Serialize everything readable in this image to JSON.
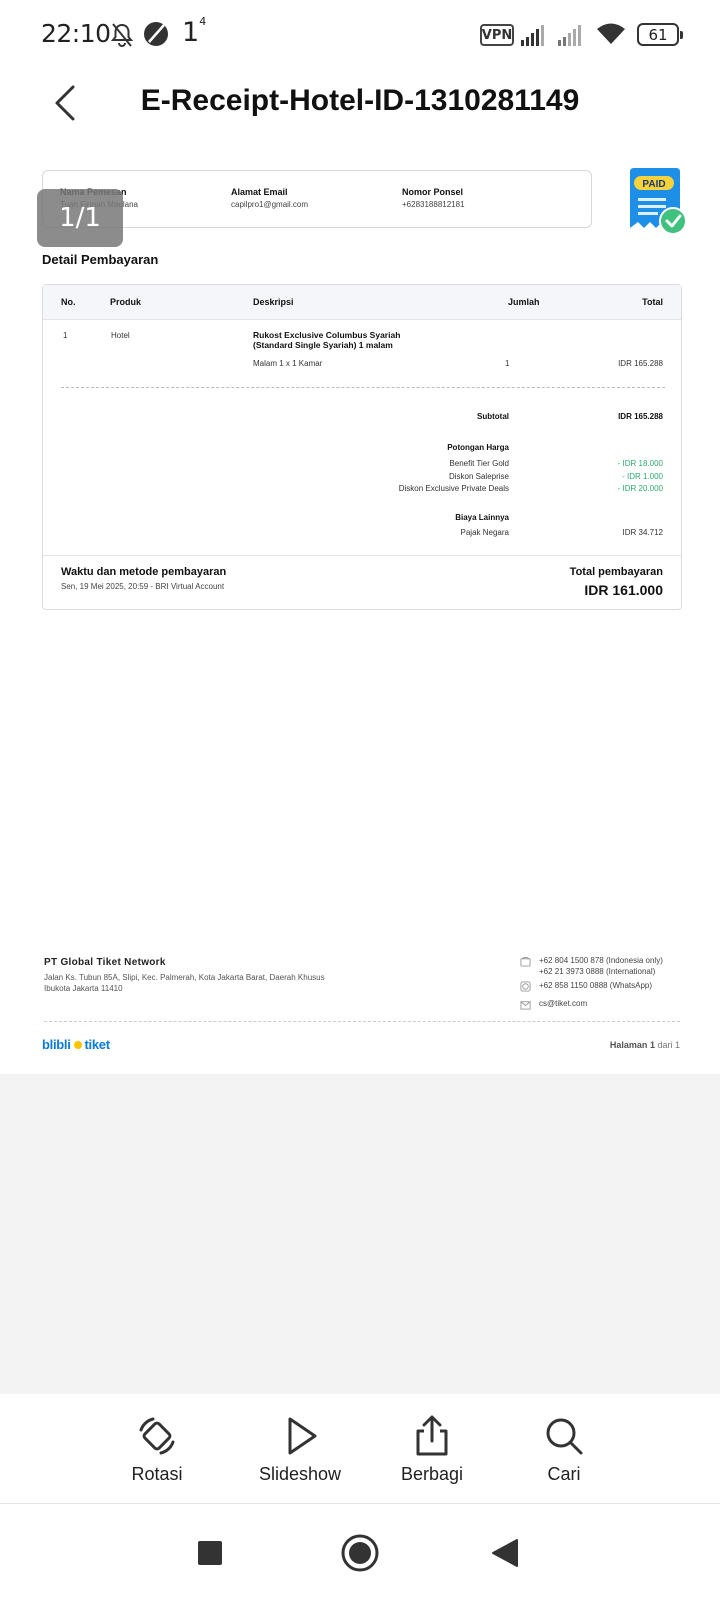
{
  "status_bar": {
    "time": "22:10",
    "extra_digit": "1",
    "extra_sup": "4",
    "vpn": "VPN",
    "battery": "61"
  },
  "header": {
    "title": "E-Receipt-Hotel-ID-1310281149"
  },
  "page_indicator": "1/1",
  "info": {
    "name_label": "Nama Pemesan",
    "name_value": "Tuan Firman Maulana",
    "email_label": "Alamat Email",
    "email_value": "capilpro1@gmail.com",
    "phone_label": "Nomor Ponsel",
    "phone_value": "+6283188812181"
  },
  "badge": "PAID",
  "payment_details": {
    "section_title": "Detail Pembayaran",
    "columns": {
      "no": "No.",
      "product": "Produk",
      "description": "Deskripsi",
      "quantity": "Jumlah",
      "total": "Total"
    },
    "row": {
      "no": "1",
      "product": "Hotel",
      "desc_line1": "Rukost Exclusive Columbus Syariah",
      "desc_line2": "(Standard Single Syariah) 1 malam",
      "desc_detail": "Malam 1 x 1 Kamar",
      "quantity": "1",
      "total": "IDR 165.288"
    },
    "subtotal_label": "Subtotal",
    "subtotal_value": "IDR 165.288",
    "discount_title": "Potongan Harga",
    "discounts": [
      {
        "label": "Benefit Tier Gold",
        "value": "- IDR 18.000"
      },
      {
        "label": "Diskon Saleprise",
        "value": "- IDR 1.000"
      },
      {
        "label": "Diskon Exclusive Private Deals",
        "value": "- IDR 20.000"
      }
    ],
    "other_title": "Biaya Lainnya",
    "tax_label": "Pajak Negara",
    "tax_value": "IDR 34.712",
    "time_method_label": "Waktu dan metode pembayaran",
    "time_method_value": "Sen, 19 Mei 2025, 20:59 - BRI Virtual Account",
    "total_label": "Total pembayaran",
    "total_value": "IDR 161.000"
  },
  "footer": {
    "company": "PT Global Tiket Network",
    "address": "Jalan Ks. Tubun 85A, Slipi, Kec. Palmerah, Kota Jakarta Barat, Daerah Khusus Ibukota Jakarta 11410",
    "phone1": "+62 804 1500 878 (Indonesia only)",
    "phone2": "+62 21 3973 0888 (International)",
    "whatsapp": "+62 858 1150 0888 (WhatsApp)",
    "email": "cs@tiket.com",
    "brand_left": "blibli",
    "brand_right": "tiket",
    "page_prefix": "Halaman",
    "page_num": "1",
    "page_suffix": "dari 1"
  },
  "toolbar": {
    "rotate": "Rotasi",
    "slideshow": "Slideshow",
    "share": "Berbagi",
    "search": "Cari"
  },
  "colors": {
    "discount_green": "#2eaa6e",
    "brand_blue": "#0a7bd6",
    "brand_yellow": "#f8c400",
    "badge_blue": "#1e8fe6"
  },
  "icons": {
    "status": [
      "mute-bell-icon",
      "data-saver-icon",
      "signal-icon",
      "wifi-icon",
      "battery-icon"
    ],
    "toolbar": [
      "rotate-icon",
      "play-icon",
      "share-icon",
      "search-icon"
    ]
  }
}
